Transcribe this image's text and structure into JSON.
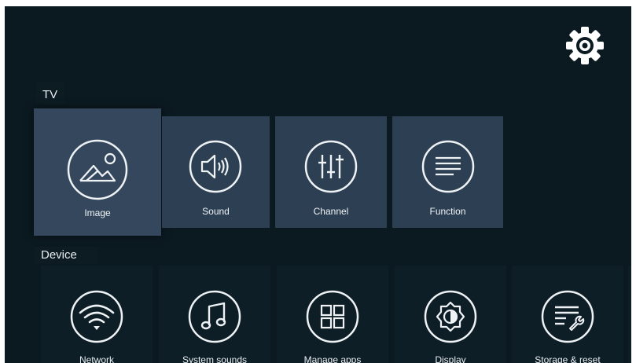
{
  "tv": {
    "section_label": "TV",
    "tiles": [
      {
        "label": "Image",
        "icon": "image-icon",
        "selected": true
      },
      {
        "label": "Sound",
        "icon": "speaker-icon"
      },
      {
        "label": "Channel",
        "icon": "equalizer-icon"
      },
      {
        "label": "Function",
        "icon": "menu-lines-icon"
      }
    ]
  },
  "device": {
    "section_label": "Device",
    "tiles": [
      {
        "label": "Network",
        "icon": "wifi-icon"
      },
      {
        "label": "System sounds",
        "icon": "music-note-icon"
      },
      {
        "label": "Manage apps",
        "icon": "grid-icon"
      },
      {
        "label": "Display",
        "icon": "brightness-icon"
      },
      {
        "label": "Storage & reset",
        "icon": "storage-wrench-icon"
      }
    ]
  },
  "settings_icon": "gear-icon",
  "colors": {
    "background": "#0b1a21",
    "tile": "#2d3f52",
    "selected_tile": "#34475c"
  }
}
